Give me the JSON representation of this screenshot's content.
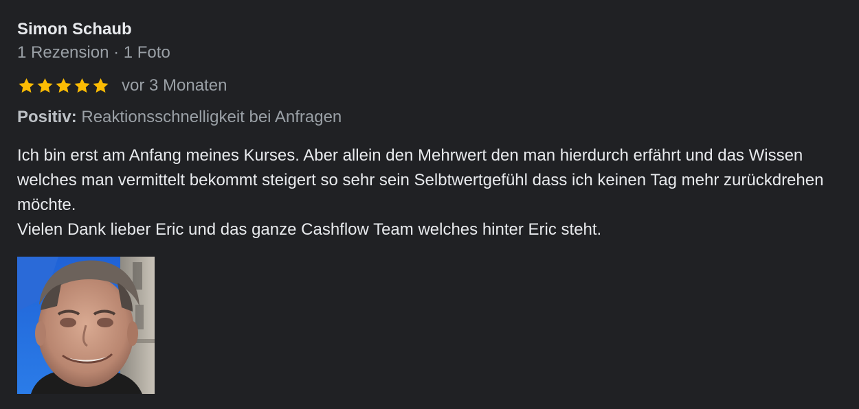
{
  "review": {
    "author_name": "Simon Schaub",
    "author_meta": "1 Rezension · 1 Foto",
    "rating": {
      "stars": 5,
      "max": 5,
      "star_color": "#fbbc04"
    },
    "date": "vor 3 Monaten",
    "highlight": {
      "label": "Positiv:",
      "value": "Reaktionsschnelligkeit bei Anfragen"
    },
    "text_lines": [
      "Ich bin erst am Anfang meines Kurses. Aber allein den Mehrwert den man hierdurch erfährt und das Wissen welches man vermittelt bekommt steigert so sehr sein Selbtwertgefühl dass ich keinen Tag mehr zurückdrehen möchte.",
      "Vielen Dank lieber Eric und das ganze Cashflow Team welches hinter Eric steht."
    ],
    "photo": {
      "icon": "reviewer-photo"
    }
  },
  "colors": {
    "background": "#202124",
    "primary_text": "#e8eaed",
    "secondary_text": "#9aa0a6"
  }
}
